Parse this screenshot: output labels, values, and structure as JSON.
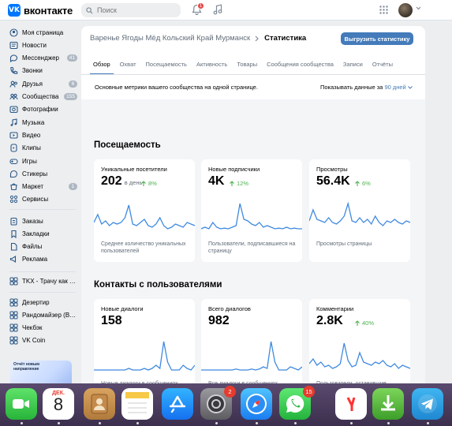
{
  "app": {
    "logo_mark": "VK",
    "logo_text": "вконтакте",
    "search_placeholder": "Поиск",
    "notifications_count": "1"
  },
  "sidebar": {
    "items": [
      {
        "label": "Моя страница",
        "icon": "user-circle-icon",
        "badge": ""
      },
      {
        "label": "Новости",
        "icon": "news-icon",
        "badge": ""
      },
      {
        "label": "Мессенджер",
        "icon": "message-icon",
        "badge": "41"
      },
      {
        "label": "Звонки",
        "icon": "phone-icon",
        "badge": ""
      },
      {
        "label": "Друзья",
        "icon": "friends-icon",
        "badge": "6"
      },
      {
        "label": "Сообщества",
        "icon": "communities-icon",
        "badge": "155"
      },
      {
        "label": "Фотографии",
        "icon": "photo-icon",
        "badge": ""
      },
      {
        "label": "Музыка",
        "icon": "music-icon",
        "badge": ""
      },
      {
        "label": "Видео",
        "icon": "video-icon",
        "badge": ""
      },
      {
        "label": "Клипы",
        "icon": "clips-icon",
        "badge": ""
      },
      {
        "label": "Игры",
        "icon": "games-icon",
        "badge": ""
      },
      {
        "label": "Стикеры",
        "icon": "stickers-icon",
        "badge": ""
      },
      {
        "label": "Маркет",
        "icon": "market-icon",
        "badge": "1"
      },
      {
        "label": "Сервисы",
        "icon": "services-icon",
        "badge": ""
      }
    ],
    "items2": [
      {
        "label": "Заказы",
        "icon": "orders-icon"
      },
      {
        "label": "Закладки",
        "icon": "bookmark-icon"
      },
      {
        "label": "Файлы",
        "icon": "files-icon"
      },
      {
        "label": "Реклама",
        "icon": "ads-icon"
      }
    ],
    "items3": [
      {
        "label": "TKX - Трачу как …",
        "icon": "app-icon"
      }
    ],
    "items4": [
      {
        "label": "Дезертир",
        "icon": "app-icon"
      },
      {
        "label": "Рандомайзер (В…",
        "icon": "app-icon"
      },
      {
        "label": "Чекбэк",
        "icon": "app-icon"
      },
      {
        "label": "VK Coin",
        "icon": "app-icon"
      }
    ],
    "promo_text": "Отчёт новым направление"
  },
  "header": {
    "community": "Варенье Ягоды Мёд Кольский Край Мурманск",
    "page": "Статистика",
    "export_label": "Выгрузить статистику"
  },
  "tabs": [
    "Обзор",
    "Охват",
    "Посещаемость",
    "Активность",
    "Товары",
    "Сообщения сообщества",
    "Записи",
    "Отчёты"
  ],
  "summary": {
    "description": "Основные метрики вашего сообщества на одной странице.",
    "period_label": "Показывать данные за",
    "period_value": "90 дней"
  },
  "sections": [
    {
      "title": "Посещаемость",
      "cards": [
        {
          "title": "Уникальные посетители",
          "value": "202",
          "unit": "в день",
          "change": "8%",
          "caption": "Среднее количество уникальных пользователей"
        },
        {
          "title": "Новые подписчики",
          "value": "4K",
          "unit": "",
          "change": "12%",
          "caption": "Пользователи, подписавшиеся на страницу"
        },
        {
          "title": "Просмотры",
          "value": "56.4K",
          "unit": "",
          "change": "6%",
          "caption": "Просмотры страницы"
        }
      ]
    },
    {
      "title": "Контакты с пользователями",
      "cards": [
        {
          "title": "Новые диалоги",
          "value": "158",
          "unit": "",
          "change": "",
          "caption": "Новые диалоги в сообщениях сообщества"
        },
        {
          "title": "Всего диалогов",
          "value": "982",
          "unit": "",
          "change": "",
          "caption": "Все диалоги в сообщениях сообщества"
        },
        {
          "title": "Комментарии",
          "value": "2.8K",
          "unit": "",
          "change": "40%",
          "caption": "Пользователи, оставившие комментарии"
        }
      ]
    }
  ],
  "sparklines": [
    [
      0.3,
      0.55,
      0.25,
      0.35,
      0.2,
      0.3,
      0.25,
      0.3,
      0.45,
      0.85,
      0.25,
      0.2,
      0.3,
      0.4,
      0.2,
      0.15,
      0.25,
      0.45,
      0.2,
      0.1,
      0.15,
      0.25,
      0.2,
      0.15,
      0.3,
      0.25,
      0.2
    ],
    [
      0.1,
      0.15,
      0.1,
      0.3,
      0.15,
      0.1,
      0.12,
      0.1,
      0.15,
      0.2,
      0.9,
      0.4,
      0.35,
      0.25,
      0.2,
      0.3,
      0.15,
      0.2,
      0.15,
      0.1,
      0.12,
      0.1,
      0.15,
      0.1,
      0.12,
      0.1,
      0.1
    ],
    [
      0.35,
      0.7,
      0.4,
      0.35,
      0.3,
      0.45,
      0.3,
      0.25,
      0.35,
      0.5,
      0.9,
      0.35,
      0.3,
      0.45,
      0.3,
      0.4,
      0.25,
      0.5,
      0.3,
      0.2,
      0.35,
      0.3,
      0.4,
      0.3,
      0.25,
      0.35,
      0.3
    ],
    [
      0.05,
      0.05,
      0.05,
      0.05,
      0.05,
      0.05,
      0.05,
      0.05,
      0.05,
      0.1,
      0.05,
      0.05,
      0.05,
      0.1,
      0.05,
      0.1,
      0.2,
      0.1,
      0.95,
      0.3,
      0.05,
      0.05,
      0.05,
      0.2,
      0.1,
      0.05,
      0.2
    ],
    [
      0.05,
      0.05,
      0.05,
      0.05,
      0.05,
      0.05,
      0.05,
      0.05,
      0.05,
      0.08,
      0.05,
      0.05,
      0.05,
      0.08,
      0.05,
      0.08,
      0.15,
      0.1,
      0.95,
      0.3,
      0.05,
      0.05,
      0.05,
      0.15,
      0.1,
      0.05,
      0.15
    ],
    [
      0.25,
      0.4,
      0.2,
      0.3,
      0.15,
      0.2,
      0.1,
      0.15,
      0.25,
      0.9,
      0.35,
      0.15,
      0.2,
      0.6,
      0.3,
      0.25,
      0.2,
      0.3,
      0.25,
      0.35,
      0.2,
      0.15,
      0.25,
      0.1,
      0.2,
      0.15,
      0.1
    ]
  ],
  "colors": {
    "accent": "#447bba",
    "chart_line": "#3f8ae0",
    "positive": "#4bb34b",
    "brand": "#0077ff"
  },
  "dock": [
    {
      "name": "FaceTime",
      "icon": "facetime-icon",
      "badge": ""
    },
    {
      "name": "Calendar",
      "icon": "calendar-icon",
      "badge": "",
      "month": "ДЕК.",
      "day": "8"
    },
    {
      "name": "Contacts",
      "icon": "contacts-icon",
      "badge": ""
    },
    {
      "name": "Notes",
      "icon": "notes-icon",
      "badge": ""
    },
    {
      "name": "App Store",
      "icon": "appstore-icon",
      "badge": ""
    },
    {
      "name": "System Settings",
      "icon": "settings-icon",
      "badge": "2"
    },
    {
      "name": "Safari",
      "icon": "safari-icon",
      "badge": ""
    },
    {
      "name": "WhatsApp",
      "icon": "whatsapp-icon",
      "badge": "15"
    },
    {
      "name": "Yandex",
      "icon": "yandex-icon",
      "badge": ""
    },
    {
      "name": "Torrent",
      "icon": "torrent-icon",
      "badge": ""
    },
    {
      "name": "Telegram",
      "icon": "telegram-icon",
      "badge": ""
    }
  ]
}
